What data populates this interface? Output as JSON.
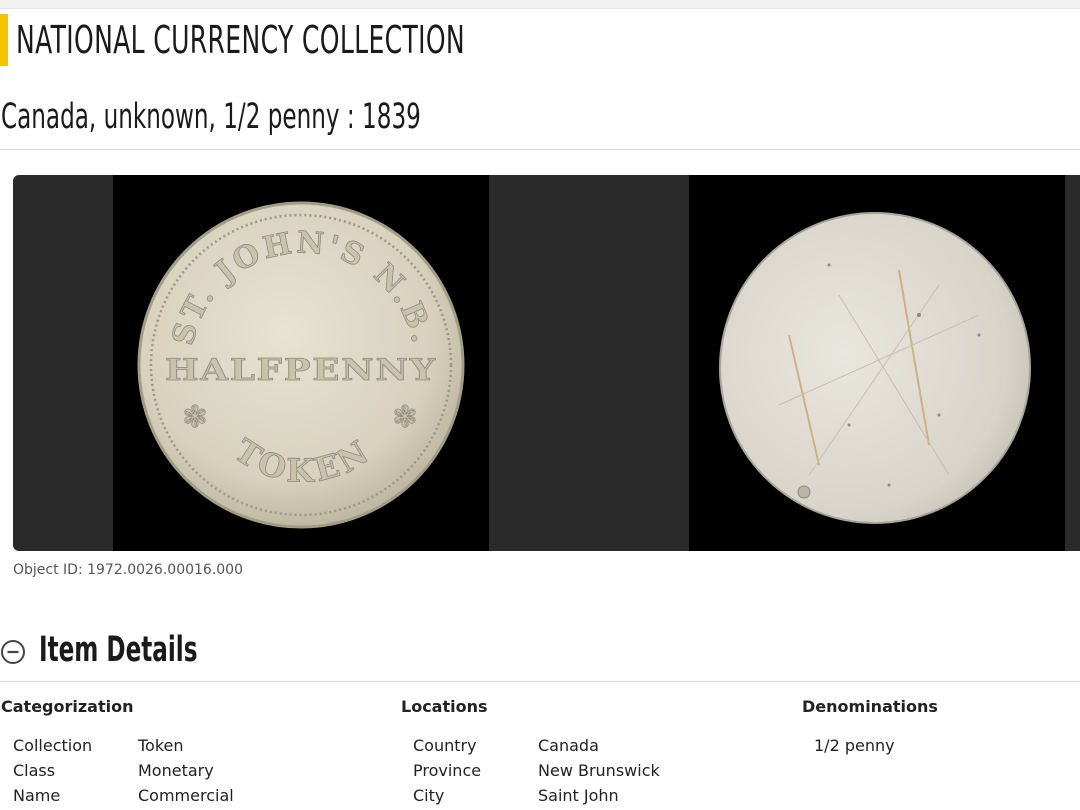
{
  "site": {
    "title": "NATIONAL CURRENCY COLLECTION",
    "accent_color": "#f5c400"
  },
  "item": {
    "title": "Canada, unknown, 1/2 penny : 1839",
    "object_id": "Object ID: 1972.0026.00016.000"
  },
  "gallery": {
    "front": {
      "top_text": "ST. JOHN'S N.B.",
      "center_text": "HALFPENNY",
      "bottom_text": "TOKEN"
    }
  },
  "details": {
    "title": "Item Details",
    "toggle_icon": "minus-circle-icon",
    "categorization": {
      "heading": "Categorization",
      "rows": [
        {
          "label": "Collection",
          "value": "Token"
        },
        {
          "label": "Class",
          "value": "Monetary"
        },
        {
          "label": "Name",
          "value": "Commercial"
        }
      ]
    },
    "locations": {
      "heading": "Locations",
      "rows": [
        {
          "label": "Country",
          "value": "Canada"
        },
        {
          "label": "Province",
          "value": "New Brunswick"
        },
        {
          "label": "City",
          "value": "Saint John"
        }
      ]
    },
    "denominations": {
      "heading": "Denominations",
      "rows": [
        {
          "value": "1/2 penny"
        }
      ]
    }
  }
}
